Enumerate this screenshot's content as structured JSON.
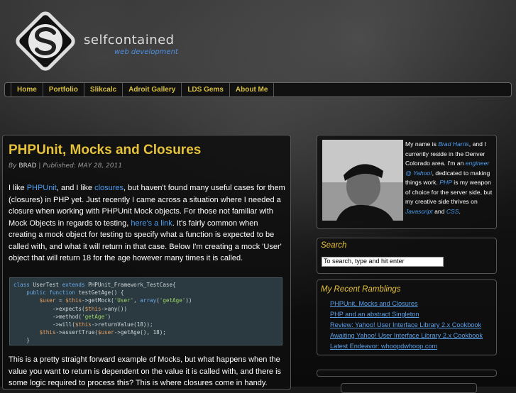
{
  "header": {
    "brand": "selfcontained",
    "tagline": "web development"
  },
  "nav": {
    "items": [
      "Home",
      "Portfolio",
      "Slikcalc",
      "Adroit Gallery",
      "LDS Gems",
      "About Me"
    ]
  },
  "post": {
    "title": "PHPUnit, Mocks and Closures",
    "by_label": "By",
    "author": "BRAD",
    "published_label": "Published:",
    "date": "MAY 28, 2011",
    "p1_a": "I like ",
    "p1_link1": "PHPUnit",
    "p1_b": ", and I like ",
    "p1_link2": "closures",
    "p1_c": ", but haven't found many useful cases for them (closures) in PHP yet. Just recently I came across a situation where I needed a closure when working with PHPUnit Mock objects. For those not familiar with Mock Objects in regards to testing, ",
    "p1_link3": "here's a link",
    "p1_d": ". It's fairly common when creating a mock object for testing to specify what a function is expected to be called with, and what it will return in that case. Below I'm creating a mock 'User' object that will return 18 for the age however many times it is called.",
    "p2": "This is a pretty straight forward example of Mocks, but what happens when the value you want to return is dependent on the value it is called with, and there is some logic required to process this? This is where closures come in handy."
  },
  "about": {
    "t1": "My name is ",
    "name": "Brad Harris",
    "t2": ", and I currently reside in the Denver Colorado area. I'm an ",
    "job": "engineer @ Yahoo!",
    "t3": ", dedicated to making things work. ",
    "php": "PHP",
    "t4": " is my weapon of choice for the server side, but my creative side thrives on ",
    "js": "Javascript",
    "t5": " and ",
    "css": "CSS",
    "t6": "."
  },
  "search": {
    "title": "Search",
    "value": "To search, type and hit enter"
  },
  "ramblings": {
    "title": "My Recent Ramblings",
    "items": [
      "PHPUnit, Mocks and Closures",
      "PHP and an abstract Singleton",
      "Review: Yahoo! User Interface Library 2.x Cookbook",
      "Awaiting Yahoo! User Interface Library 2.x Cookbook",
      "Latest Endeavor: whoopdwhoop.com"
    ]
  }
}
